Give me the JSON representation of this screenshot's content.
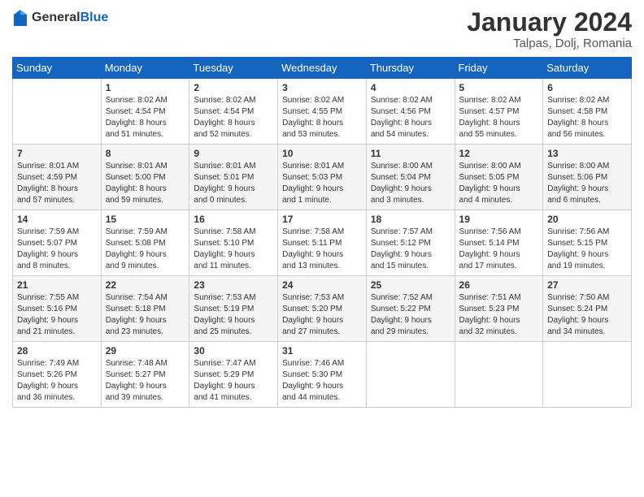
{
  "header": {
    "logo_general": "General",
    "logo_blue": "Blue",
    "month_title": "January 2024",
    "location": "Talpas, Dolj, Romania"
  },
  "weekdays": [
    "Sunday",
    "Monday",
    "Tuesday",
    "Wednesday",
    "Thursday",
    "Friday",
    "Saturday"
  ],
  "weeks": [
    [
      {
        "day": "",
        "info": ""
      },
      {
        "day": "1",
        "info": "Sunrise: 8:02 AM\nSunset: 4:54 PM\nDaylight: 8 hours\nand 51 minutes."
      },
      {
        "day": "2",
        "info": "Sunrise: 8:02 AM\nSunset: 4:54 PM\nDaylight: 8 hours\nand 52 minutes."
      },
      {
        "day": "3",
        "info": "Sunrise: 8:02 AM\nSunset: 4:55 PM\nDaylight: 8 hours\nand 53 minutes."
      },
      {
        "day": "4",
        "info": "Sunrise: 8:02 AM\nSunset: 4:56 PM\nDaylight: 8 hours\nand 54 minutes."
      },
      {
        "day": "5",
        "info": "Sunrise: 8:02 AM\nSunset: 4:57 PM\nDaylight: 8 hours\nand 55 minutes."
      },
      {
        "day": "6",
        "info": "Sunrise: 8:02 AM\nSunset: 4:58 PM\nDaylight: 8 hours\nand 56 minutes."
      }
    ],
    [
      {
        "day": "7",
        "info": "Sunrise: 8:01 AM\nSunset: 4:59 PM\nDaylight: 8 hours\nand 57 minutes."
      },
      {
        "day": "8",
        "info": "Sunrise: 8:01 AM\nSunset: 5:00 PM\nDaylight: 8 hours\nand 59 minutes."
      },
      {
        "day": "9",
        "info": "Sunrise: 8:01 AM\nSunset: 5:01 PM\nDaylight: 9 hours\nand 0 minutes."
      },
      {
        "day": "10",
        "info": "Sunrise: 8:01 AM\nSunset: 5:03 PM\nDaylight: 9 hours\nand 1 minute."
      },
      {
        "day": "11",
        "info": "Sunrise: 8:00 AM\nSunset: 5:04 PM\nDaylight: 9 hours\nand 3 minutes."
      },
      {
        "day": "12",
        "info": "Sunrise: 8:00 AM\nSunset: 5:05 PM\nDaylight: 9 hours\nand 4 minutes."
      },
      {
        "day": "13",
        "info": "Sunrise: 8:00 AM\nSunset: 5:06 PM\nDaylight: 9 hours\nand 6 minutes."
      }
    ],
    [
      {
        "day": "14",
        "info": "Sunrise: 7:59 AM\nSunset: 5:07 PM\nDaylight: 9 hours\nand 8 minutes."
      },
      {
        "day": "15",
        "info": "Sunrise: 7:59 AM\nSunset: 5:08 PM\nDaylight: 9 hours\nand 9 minutes."
      },
      {
        "day": "16",
        "info": "Sunrise: 7:58 AM\nSunset: 5:10 PM\nDaylight: 9 hours\nand 11 minutes."
      },
      {
        "day": "17",
        "info": "Sunrise: 7:58 AM\nSunset: 5:11 PM\nDaylight: 9 hours\nand 13 minutes."
      },
      {
        "day": "18",
        "info": "Sunrise: 7:57 AM\nSunset: 5:12 PM\nDaylight: 9 hours\nand 15 minutes."
      },
      {
        "day": "19",
        "info": "Sunrise: 7:56 AM\nSunset: 5:14 PM\nDaylight: 9 hours\nand 17 minutes."
      },
      {
        "day": "20",
        "info": "Sunrise: 7:56 AM\nSunset: 5:15 PM\nDaylight: 9 hours\nand 19 minutes."
      }
    ],
    [
      {
        "day": "21",
        "info": "Sunrise: 7:55 AM\nSunset: 5:16 PM\nDaylight: 9 hours\nand 21 minutes."
      },
      {
        "day": "22",
        "info": "Sunrise: 7:54 AM\nSunset: 5:18 PM\nDaylight: 9 hours\nand 23 minutes."
      },
      {
        "day": "23",
        "info": "Sunrise: 7:53 AM\nSunset: 5:19 PM\nDaylight: 9 hours\nand 25 minutes."
      },
      {
        "day": "24",
        "info": "Sunrise: 7:53 AM\nSunset: 5:20 PM\nDaylight: 9 hours\nand 27 minutes."
      },
      {
        "day": "25",
        "info": "Sunrise: 7:52 AM\nSunset: 5:22 PM\nDaylight: 9 hours\nand 29 minutes."
      },
      {
        "day": "26",
        "info": "Sunrise: 7:51 AM\nSunset: 5:23 PM\nDaylight: 9 hours\nand 32 minutes."
      },
      {
        "day": "27",
        "info": "Sunrise: 7:50 AM\nSunset: 5:24 PM\nDaylight: 9 hours\nand 34 minutes."
      }
    ],
    [
      {
        "day": "28",
        "info": "Sunrise: 7:49 AM\nSunset: 5:26 PM\nDaylight: 9 hours\nand 36 minutes."
      },
      {
        "day": "29",
        "info": "Sunrise: 7:48 AM\nSunset: 5:27 PM\nDaylight: 9 hours\nand 39 minutes."
      },
      {
        "day": "30",
        "info": "Sunrise: 7:47 AM\nSunset: 5:29 PM\nDaylight: 9 hours\nand 41 minutes."
      },
      {
        "day": "31",
        "info": "Sunrise: 7:46 AM\nSunset: 5:30 PM\nDaylight: 9 hours\nand 44 minutes."
      },
      {
        "day": "",
        "info": ""
      },
      {
        "day": "",
        "info": ""
      },
      {
        "day": "",
        "info": ""
      }
    ]
  ]
}
